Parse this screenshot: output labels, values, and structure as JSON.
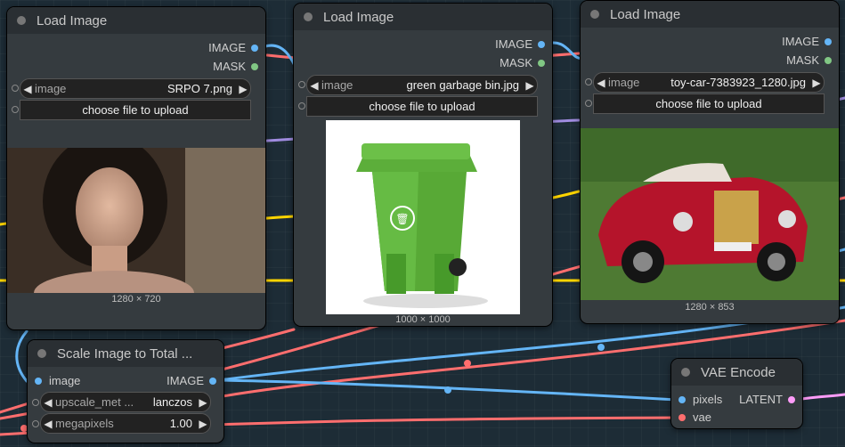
{
  "nodes": {
    "load1": {
      "title": "Load Image",
      "out_image": "IMAGE",
      "out_mask": "MASK",
      "widget_label": "image",
      "widget_value": "SRPO 7.png",
      "upload": "choose file to upload",
      "dims": "1280 × 720"
    },
    "load2": {
      "title": "Load Image",
      "out_image": "IMAGE",
      "out_mask": "MASK",
      "widget_label": "image",
      "widget_value": "green garbage bin.jpg",
      "upload": "choose file to upload",
      "dims": "1000 × 1000"
    },
    "load3": {
      "title": "Load Image",
      "out_image": "IMAGE",
      "out_mask": "MASK",
      "widget_label": "image",
      "widget_value": "toy-car-7383923_1280.jpg",
      "upload": "choose file to upload",
      "dims": "1280 × 853"
    },
    "scale": {
      "title": "Scale Image to Total ...",
      "in_image": "image",
      "out_image": "IMAGE",
      "w1_label": "upscale_met ...",
      "w1_value": "lanczos",
      "w2_label": "megapixels",
      "w2_value": "1.00"
    },
    "vae": {
      "title": "VAE Encode",
      "in_pixels": "pixels",
      "in_vae": "vae",
      "out_latent": "LATENT"
    }
  },
  "colors": {
    "image_link": "#64b5f6",
    "mask_socket": "#81c784",
    "vae_link": "#ff6e6e",
    "latent_link": "#ff9cf9",
    "clip_link": "#ffd500",
    "conditioning_link": "#a08ce0"
  },
  "icons": [
    "arrow-left-icon",
    "arrow-right-icon",
    "trash-can-icon"
  ]
}
